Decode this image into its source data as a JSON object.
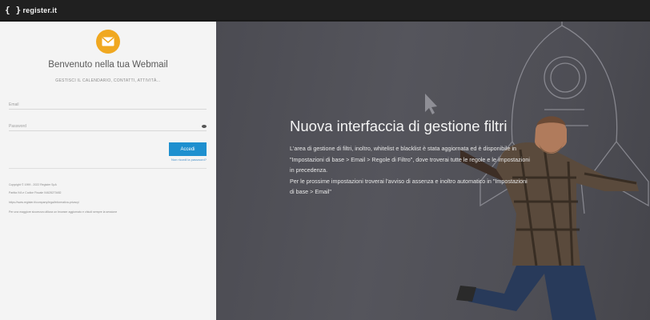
{
  "brand": {
    "logo_text": "register.it"
  },
  "login": {
    "welcome": "Benvenuto nella tua Webmail",
    "subtitle": "GESTISCI IL CALENDARIO, CONTATTI, ATTIVITÀ...",
    "email_placeholder": "Email",
    "password_placeholder": "Password",
    "submit_label": "Accedi",
    "forgot_label": "Non ricordi la password?"
  },
  "footer": {
    "line1": "Copyright © 1999 - 2022 Register SpA",
    "line2": "Partita IVA e Codice Fiscale 04628270482",
    "line3": "https://www.register.it/company/legal/informativa-privacy/",
    "line4": "Per una maggiore sicurezza utilizza un browser aggiornato e chiudi sempre la sessione"
  },
  "promo": {
    "headline": "Nuova interfaccia di gestione filtri",
    "line1": "L'area di gestione di filtri, inoltro, whitelist e blacklist è stata aggiornata ed è disponibile in",
    "line2": "\"Impostazioni di base > Email > Regole di Filtro\", dove troverai tutte le regole e le impostazioni",
    "line3": "in precedenza.",
    "line4": "Per le prossime impostazioni troverai l'avviso di assenza e inoltro automatico in \"Impostazioni",
    "line5": "di base > Email\""
  },
  "colors": {
    "accent": "#1e90cf",
    "mail_icon": "#f0a820",
    "topbar": "#202020",
    "panel": "#4e4e55"
  },
  "icons": {
    "mail": "envelope-icon",
    "cursor": "cursor-icon",
    "eye": "eye-icon",
    "rocket": "rocket-icon"
  }
}
